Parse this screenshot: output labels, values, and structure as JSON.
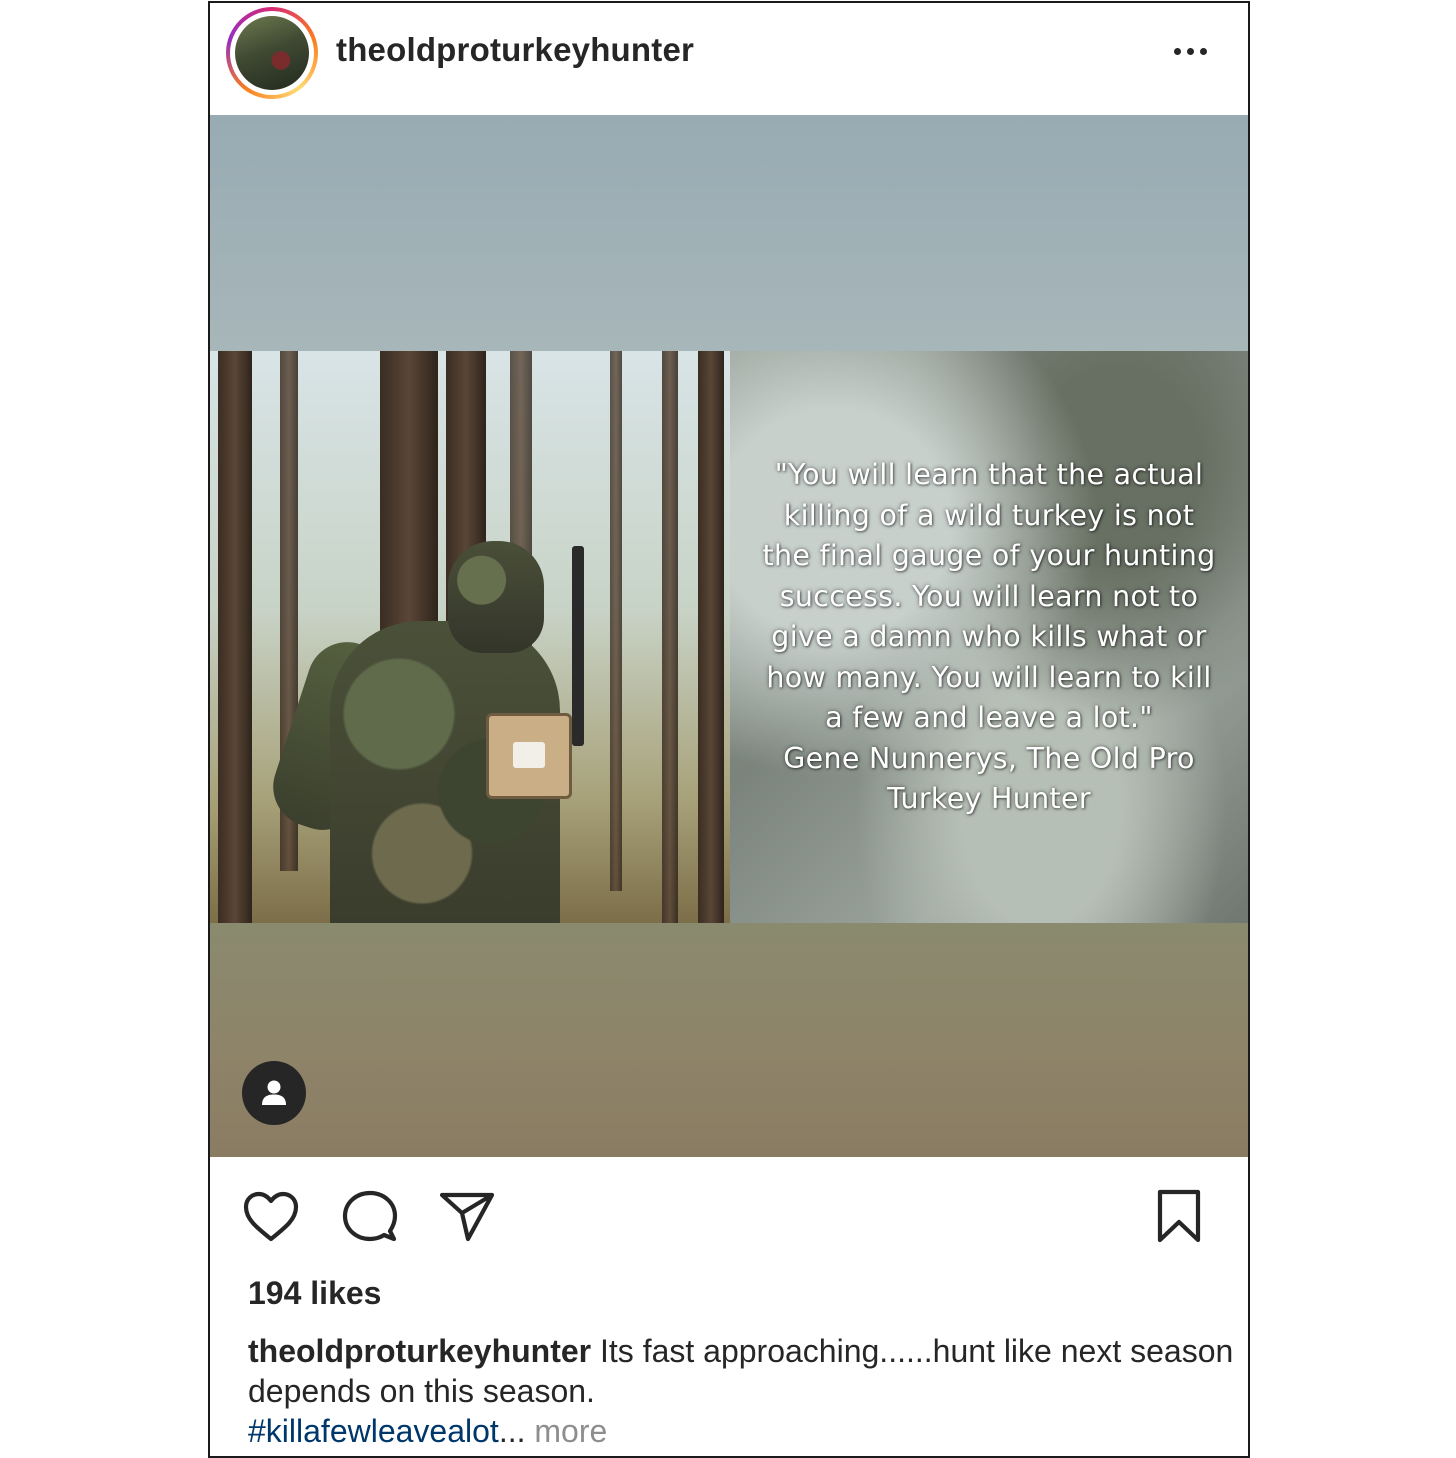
{
  "post": {
    "username": "theoldproturkeyhunter",
    "media": {
      "quote_lines": "\"You will learn that the actual\nkilling of a wild turkey is not\nthe final gauge of your hunting\nsuccess.  You will learn not to\ngive a damn who kills what or\nhow many.  You will learn to kill\na few and leave a lot.\"\nGene Nunnerys, The Old Pro\nTurkey Hunter"
    },
    "likes": "194 likes",
    "caption": {
      "username": "theoldproturkeyhunter",
      "text": " Its fast approaching......hunt like next season depends on this season.",
      "hashtag": "#killafewleavealot",
      "ellipsis": "...",
      "more": " more"
    }
  },
  "icons": {
    "menu": "more-horizontal-icon",
    "tag": "user-tag-icon",
    "like": "heart-icon",
    "comment": "comment-icon",
    "share": "paper-plane-icon",
    "save": "bookmark-icon"
  },
  "colors": {
    "text": "#262626",
    "hashtag": "#00376b",
    "muted": "#8e8e8e",
    "story_ring": [
      "#d62976",
      "#fa7e1e",
      "#feda75",
      "#962fbf"
    ]
  }
}
